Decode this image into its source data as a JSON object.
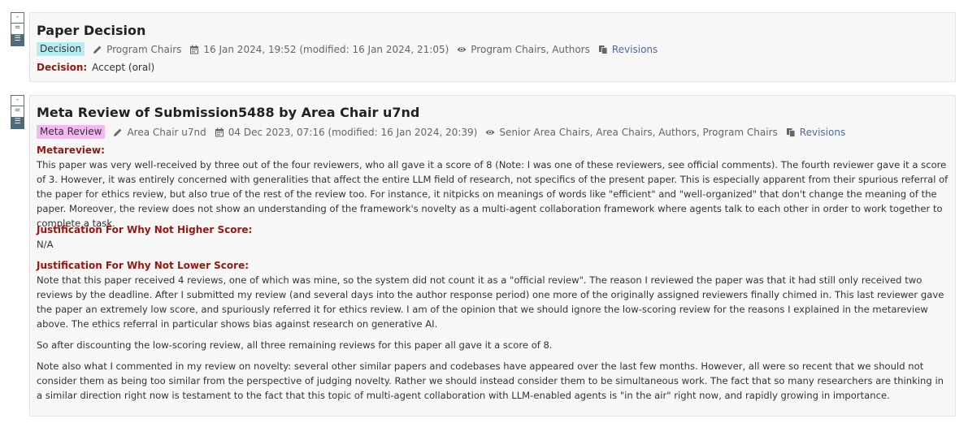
{
  "controls": {
    "collapse": "-",
    "expand_partial": "=",
    "expand_full": "☰"
  },
  "decision_note": {
    "title": "Paper Decision",
    "badge": "Decision",
    "signature": "Program Chairs",
    "date": "16 Jan 2024, 19:52 (modified: 16 Jan 2024, 21:05)",
    "readers": "Program Chairs, Authors",
    "revisions_label": "Revisions",
    "decision_label": "Decision:",
    "decision_value": "Accept (oral)",
    "badge_color": "#b7ecf2"
  },
  "meta_note": {
    "title": "Meta Review of Submission5488 by Area Chair u7nd",
    "badge": "Meta Review",
    "signature": "Area Chair u7nd",
    "date": "04 Dec 2023, 07:16 (modified: 16 Jan 2024, 20:39)",
    "readers": "Senior Area Chairs, Area Chairs, Authors, Program Chairs",
    "revisions_label": "Revisions",
    "badge_color": "#f2b8f0",
    "metareview_label": "Metareview:",
    "metareview_text": "This paper was very well-received by three out of the four reviewers, who all gave it a score of 8 (Note: I was one of these reviewers, see official comments). The fourth reviewer gave it a score of 3. However, it was entirely concerned with generalities that affect the entire LLM field of research, not specifics of the present paper. This is especially apparent from their spurious referral of the paper for ethics review, but also true of the rest of the review too. For instance, it nitpicks on meanings of words like \"efficient\" and \"well-organized\" that don't change the meaning of the paper. Moreover, the review does not show an understanding of the framework's novelty as a multi-agent collaboration framework where agents talk to each other in order to work together to complete a task.",
    "higher_label": "Justification For Why Not Higher Score:",
    "higher_text": "N/A",
    "lower_label": "Justification For Why Not Lower Score:",
    "lower_p1": "Note that this paper received 4 reviews, one of which was mine, so the system did not count it as a \"official review\". The reason I reviewed the paper was that it had still only received two reviews by the deadline. After I submitted my review (and several days into the author response period) one more of the originally assigned reviewers finally chimed in. This last reviewer gave the paper an extremely low score, and spuriously referred it for ethics review. I am of the opinion that we should ignore the low-scoring review for the reasons I explained in the metareview above. The ethics referral in particular shows bias against research on generative AI.",
    "lower_p2": "So after discounting the low-scoring review, all three remaining reviews for this paper all gave it a score of 8.",
    "lower_p3": "Note also what I commented in my review on novelty: several other similar papers and codebases have appeared over the last few months. However, all were so recent that we should not consider them as being too similar from the perspective of judging novelty. Rather we should instead consider them to be simultaneous work. The fact that so many researchers are thinking in a similar direction right now is testament to the fact that this topic of multi-agent collaboration with LLM-enabled agents is \"in the air\" right now, and rapidly growing in importance."
  },
  "icons": [
    "pencil-icon",
    "calendar-icon",
    "eye-icon",
    "copy-icon"
  ]
}
